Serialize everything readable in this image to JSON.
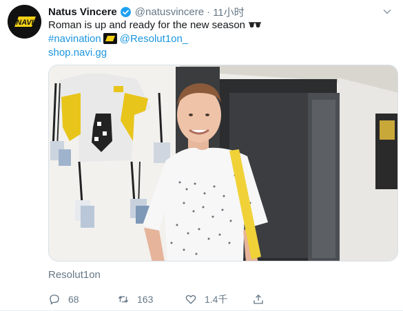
{
  "tweet": {
    "author": {
      "display_name": "Natus Vincere",
      "handle": "@natusvincere",
      "verified": true,
      "avatar_logo": "NAVI"
    },
    "timestamp": "11小时",
    "separator": "·",
    "text_line1": "Roman is up and ready for the new season",
    "emoji_glasses": "sunglasses-emoji",
    "hashtag": "#navination",
    "emoji_navi": "navi-logo-emoji",
    "mention": "@Resolut1on_",
    "link": "shop.navi.gg",
    "media": {
      "kind": "photo",
      "description_icon": "photo"
    },
    "tagged_user": "Resolut1on",
    "actions": {
      "reply_count": "68",
      "retweet_count": "163",
      "like_count": "1.4千"
    }
  },
  "colors": {
    "link": "#1b95e0",
    "muted": "#657786",
    "text": "#14171a",
    "verified": "#1da1f2",
    "navi_yellow": "#f5d116"
  }
}
